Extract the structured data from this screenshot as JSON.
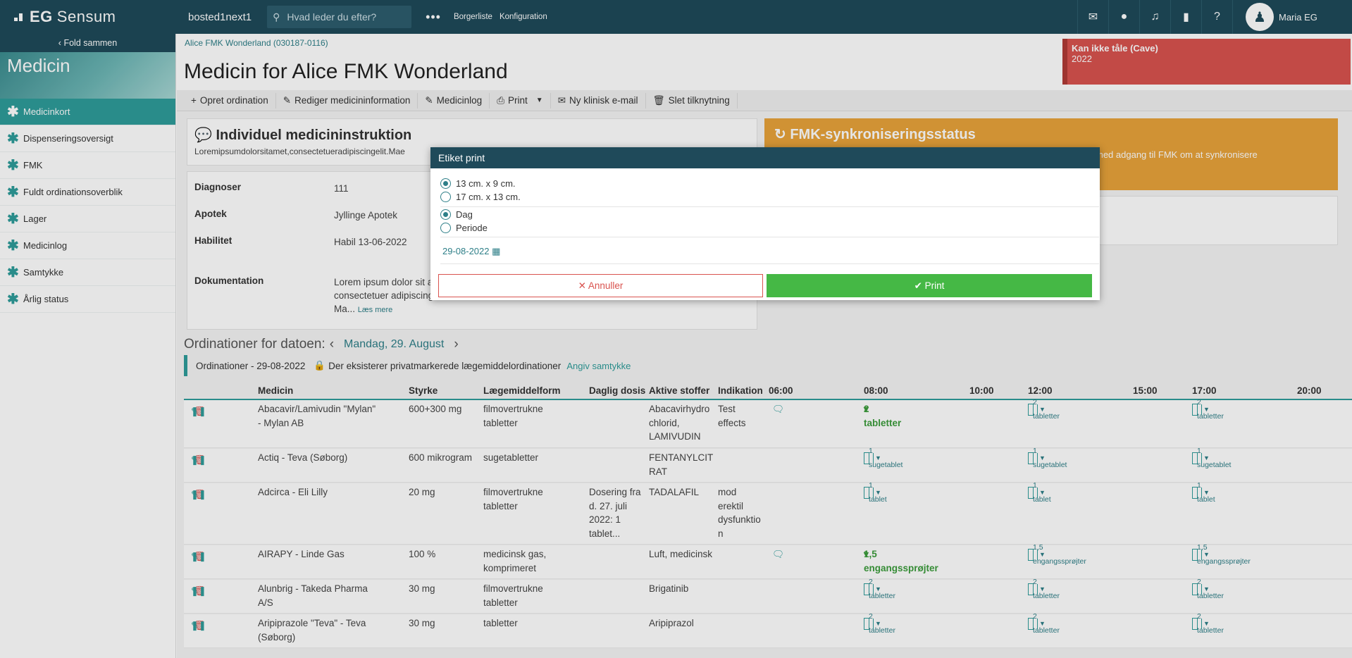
{
  "topbar": {
    "brand": "EG",
    "product": "Sensum",
    "site": "bosted1next1",
    "search_placeholder": "Hvad leder du efter?",
    "more": "•••",
    "links": [
      "Borgerliste",
      "Konfiguration"
    ],
    "user": "Maria EG"
  },
  "sidebar": {
    "fold_label": "Fold sammen",
    "section_title": "Medicin",
    "items": [
      {
        "label": "Medicinkort",
        "active": true
      },
      {
        "label": "Dispenseringsoversigt"
      },
      {
        "label": "FMK"
      },
      {
        "label": "Fuldt ordinationsoverblik"
      },
      {
        "label": "Lager"
      },
      {
        "label": "Medicinlog"
      },
      {
        "label": "Samtykke"
      },
      {
        "label": "Årlig status"
      }
    ]
  },
  "header": {
    "breadcrumb": "Alice FMK Wonderland (030187-0116)",
    "title": "Medicin for Alice FMK Wonderland",
    "cave_title": "Kan ikke tåle (Cave)",
    "cave_value": "2022"
  },
  "toolbar": {
    "items": [
      "Opret ordination",
      "Rediger medicininformation",
      "Medicinlog",
      "Print",
      "Ny klinisk e-mail",
      "Slet tilknytning"
    ]
  },
  "instruction": {
    "title": "Individuel medicininstruktion",
    "text": "Loremipsumdolorsitamet,consectetueradipiscingelit.Mae"
  },
  "info": {
    "diagnoser_label": "Diagnoser",
    "diagnoser_value": "111",
    "apotek_label": "Apotek",
    "apotek_value": "Jyllinge Apotek",
    "habilitet_label": "Habilitet",
    "habilitet_value": "Habil 13-06-2022",
    "dok_label": "Dokumentation",
    "dok_value": "Lorem ipsum dolor sit a consectetuer adipiscing elit. Ma...",
    "read_more": "Læs mere"
  },
  "fmk": {
    "title": "FMK-synkroniseringsstatus",
    "text": "med adgang til FMK om at synkronisere"
  },
  "ordinations": {
    "heading": "Ordinationer for datoen:",
    "date": "Mandag, 29. August",
    "bar_label": "Ordinationer - 29-08-2022",
    "private_note": "Der eksisterer privatmarkerede lægemiddelordinationer",
    "consent_link": "Angiv samtykke",
    "columns": {
      "medicin": "Medicin",
      "styrke": "Styrke",
      "form": "Lægemiddelform",
      "dosis": "Daglig dosis",
      "stoffer": "Aktive stoffer",
      "indikation": "Indikation",
      "t0600": "06:00",
      "t0800": "08:00",
      "t1000": "10:00",
      "t1200": "12:00",
      "t1500": "15:00",
      "t1700": "17:00",
      "t2000": "20:00"
    },
    "rows": [
      {
        "name": "Abacavir/Lamivudin \"Mylan\" - Mylan AB",
        "styrke": "600+300 mg",
        "form": "filmovertrukne tabletter",
        "dosis": "",
        "stoffer": "Abacavirhydro chlorid, LAMIVUDIN",
        "indikation": "Test effects",
        "d0800": "2 tabletter",
        "d1200": "2 tabletter",
        "d1700": "2 tabletter"
      },
      {
        "name": "Actiq - Teva (Søborg)",
        "styrke": "600 mikrogram",
        "form": "sugetabletter",
        "dosis": "",
        "stoffer": "FENTANYLCIT RAT",
        "indikation": "",
        "d0800": "1 sugetablet",
        "d1200": "1 sugetablet",
        "d1700": "1 sugetablet"
      },
      {
        "name": "Adcirca - Eli Lilly",
        "styrke": "20 mg",
        "form": "filmovertrukne tabletter",
        "dosis": "Dosering fra d. 27. juli 2022: 1 tablet...",
        "stoffer": "TADALAFIL",
        "indikation": "mod erektil dysfunktio n",
        "d0800": "1 tablet",
        "d1200": "1 tablet",
        "d1700": "1 tablet"
      },
      {
        "name": "AIRAPY - Linde Gas",
        "styrke": "100 %",
        "form": "medicinsk gas, komprimeret",
        "dosis": "",
        "stoffer": "Luft, medicinsk",
        "indikation": "",
        "d0800": "1,5 engangssprøjter",
        "d1200": "1,5 engangssprøjter",
        "d1700": "1,5 engangssprøjter"
      },
      {
        "name": "Alunbrig - Takeda Pharma A/S",
        "styrke": "30 mg",
        "form": "filmovertrukne tabletter",
        "dosis": "",
        "stoffer": "Brigatinib",
        "indikation": "",
        "d0800": "2 tabletter",
        "d1200": "2 tabletter",
        "d1700": "2 tabletter"
      },
      {
        "name": "Aripiprazole \"Teva\" - Teva (Søborg)",
        "styrke": "30 mg",
        "form": "tabletter",
        "dosis": "",
        "stoffer": "Aripiprazol",
        "indikation": "",
        "d0800": "2 tabletter",
        "d1200": "2 tabletter",
        "d1700": "2 tabletter"
      }
    ]
  },
  "modal": {
    "title": "Etiket print",
    "size_options": [
      "13 cm. x 9 cm.",
      "17 cm. x 13 cm."
    ],
    "size_selected": 0,
    "period_options": [
      "Dag",
      "Periode"
    ],
    "period_selected": 0,
    "date": "29-08-2022",
    "cancel": "Annuller",
    "print": "Print"
  },
  "colors": {
    "topbar": "#1f4a5a",
    "accent": "#2e9c9a",
    "cave": "#d9534f",
    "fmk": "#e8a33a",
    "print": "#45b845"
  }
}
